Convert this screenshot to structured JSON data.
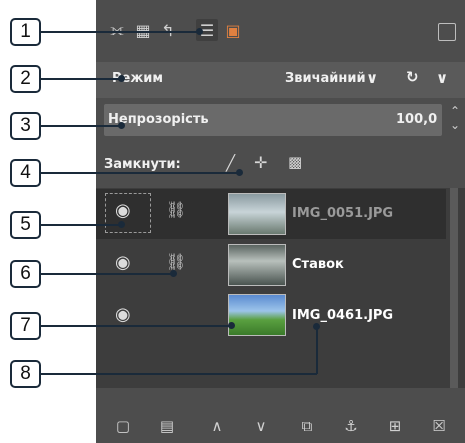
{
  "mode_row": {
    "label": "Режим",
    "value": "Звичайний",
    "dropdown_arrow": "∨",
    "composite_icon": "↻",
    "composite_arrow": "∨"
  },
  "opacity_row": {
    "label": "Непрозорість",
    "value": "100,0"
  },
  "lock_row": {
    "label": "Замкнути:"
  },
  "layers": [
    {
      "name": "IMG_0051.JPG",
      "visible": true,
      "linked": true,
      "active": true
    },
    {
      "name": "Ставок",
      "visible": true,
      "linked": true,
      "active": false
    },
    {
      "name": "IMG_0461.JPG",
      "visible": true,
      "linked": false,
      "active": false
    }
  ],
  "callouts": [
    "1",
    "2",
    "3",
    "4",
    "5",
    "6",
    "7",
    "8"
  ],
  "icons": {
    "tabs": [
      "brush-tab-icon",
      "channels-tab-icon",
      "paths-tab-icon",
      "layers-tab-icon",
      "image-tab-icon"
    ],
    "toolbar": [
      "new-layer-icon",
      "new-group-icon",
      "raise-layer-icon",
      "lower-layer-icon",
      "duplicate-layer-icon",
      "anchor-layer-icon",
      "merge-layer-icon",
      "delete-layer-icon"
    ]
  },
  "colors": {
    "panel_bg": "#4d4d4d",
    "list_bg": "#3d3d3d",
    "callout_border": "#1a2a3a"
  }
}
